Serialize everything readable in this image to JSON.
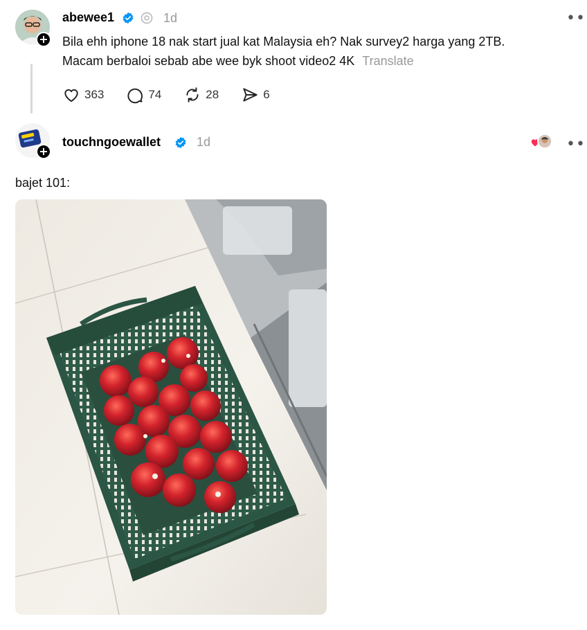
{
  "post1": {
    "username": "abewee1",
    "time": "1d",
    "text_line1": "Bila ehh iphone 18 nak start jual kat Malaysia eh? Nak survey2 harga yang 2TB.",
    "text_line2": "Macam berbaloi sebab abe wee byk shoot video2 4K",
    "translate_label": "Translate",
    "likes": "363",
    "replies": "74",
    "reposts": "28",
    "shares": "6",
    "more_label": "•••"
  },
  "post2": {
    "username": "touchngoewallet",
    "time": "1d",
    "text": "bajet 101:",
    "more_label": "•••"
  },
  "icons": {
    "verified": "verified-badge-icon",
    "threads": "threads-logo-icon",
    "like": "heart-icon",
    "reply": "comment-icon",
    "repost": "repost-icon",
    "share": "send-icon"
  },
  "colors": {
    "verified_blue": "#0095f6",
    "muted": "#999999",
    "basket_green": "#2e5a48",
    "apple_red": "#c0202a"
  }
}
